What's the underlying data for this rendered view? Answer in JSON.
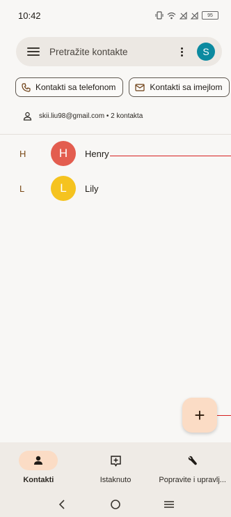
{
  "status_bar": {
    "time": "10:42",
    "battery": "95"
  },
  "search": {
    "placeholder": "Pretražite kontakte",
    "avatar_letter": "S",
    "avatar_color": "#0c8aa0"
  },
  "chips": [
    {
      "label": "Kontakti sa telefonom",
      "icon": "phone-icon"
    },
    {
      "label": "Kontakti sa imejlom",
      "icon": "mail-icon"
    }
  ],
  "account": {
    "text": "skii.liu98@gmail.com • 2 kontakta",
    "icon": "person-icon"
  },
  "contacts": [
    {
      "section": "H",
      "initial": "H",
      "name": "Henry",
      "color": "#e35d4f"
    },
    {
      "section": "L",
      "initial": "L",
      "name": "Lily",
      "color": "#f5c31f"
    }
  ],
  "fab": {
    "icon": "plus-icon",
    "symbol": "+"
  },
  "bottom_nav": [
    {
      "label": "Kontakti",
      "icon": "person-icon",
      "active": true
    },
    {
      "label": "Istaknuto",
      "icon": "star-badge-icon",
      "active": false
    },
    {
      "label": "Popravite i upravlj...",
      "icon": "wrench-icon",
      "active": false
    }
  ],
  "colors": {
    "accent": "#fbdcc5",
    "background": "#f8f7f5",
    "annotation_line": "#d62020"
  }
}
